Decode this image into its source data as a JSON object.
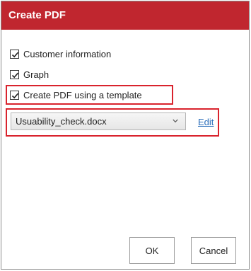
{
  "dialog": {
    "title": "Create PDF",
    "title_bar_color": "#c0262f",
    "highlight_color": "#d9232d"
  },
  "options": [
    {
      "label": "Customer information",
      "checked": true
    },
    {
      "label": "Graph",
      "checked": true
    },
    {
      "label": "Create PDF using a template",
      "checked": true
    }
  ],
  "template": {
    "selected": "Usuability_check.docx",
    "edit_label": "Edit"
  },
  "buttons": {
    "ok_label": "OK",
    "cancel_label": "Cancel"
  }
}
